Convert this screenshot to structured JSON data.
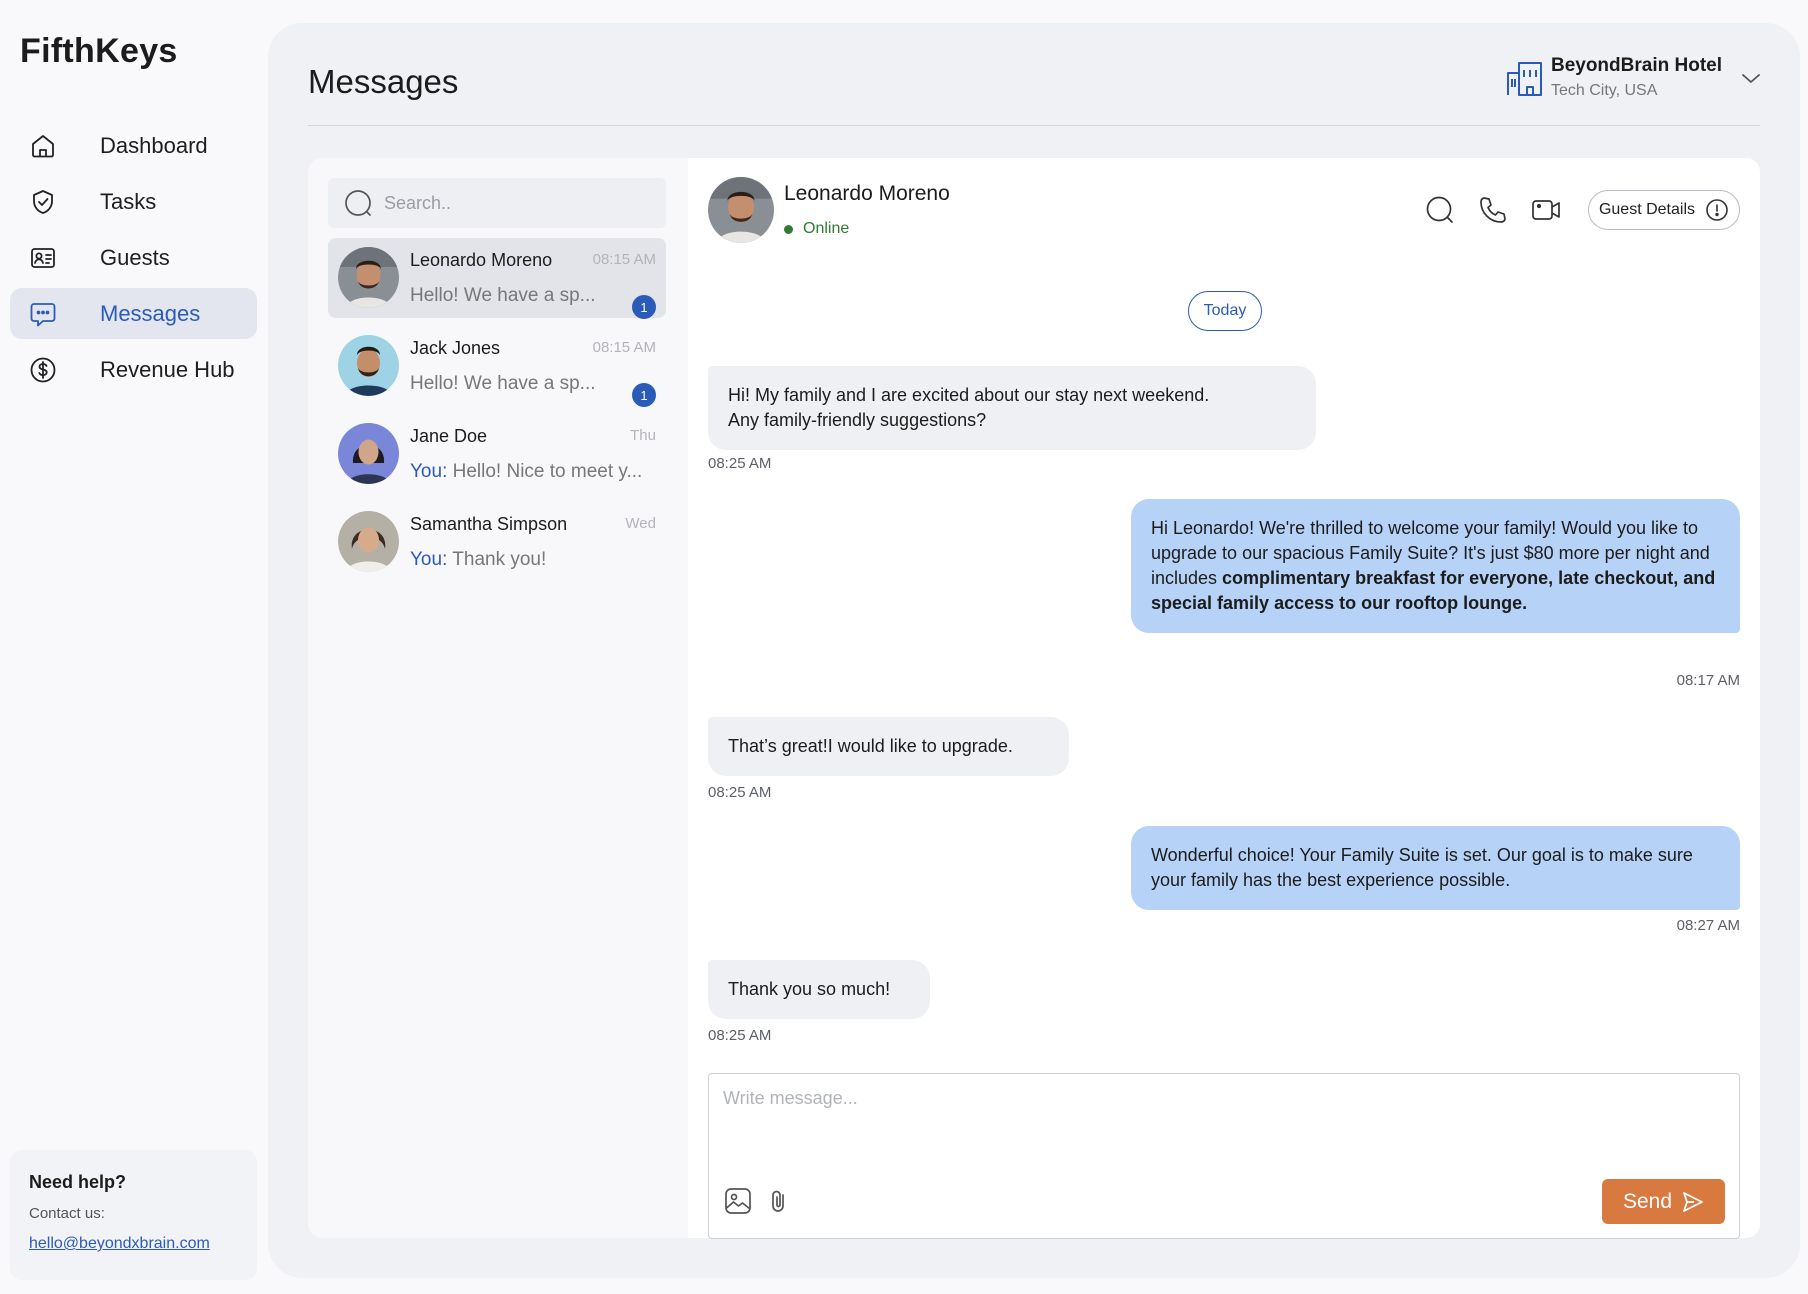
{
  "brand": "FifthKeys",
  "nav": [
    {
      "label": "Dashboard",
      "icon": "home-icon",
      "active": false
    },
    {
      "label": "Tasks",
      "icon": "check-circle-icon",
      "active": false
    },
    {
      "label": "Guests",
      "icon": "id-card-icon",
      "active": false
    },
    {
      "label": "Messages",
      "icon": "chat-bubble-icon",
      "active": true
    },
    {
      "label": "Revenue Hub",
      "icon": "dollar-circle-icon",
      "active": false
    }
  ],
  "help": {
    "title": "Need help?",
    "contact_label": "Contact us:",
    "email": "hello@beyondxbrain.com"
  },
  "header": {
    "title": "Messages",
    "hotel_name": "BeyondBrain Hotel",
    "hotel_location": "Tech City, USA"
  },
  "search": {
    "placeholder": "Search.."
  },
  "conversations": [
    {
      "name": "Leonardo Moreno",
      "time": "08:15 AM",
      "you_prefix": "",
      "preview": "Hello! We have a sp...",
      "badge": "1",
      "active": true
    },
    {
      "name": "Jack Jones",
      "time": "08:15 AM",
      "you_prefix": "",
      "preview": "Hello! We have a sp...",
      "badge": "1",
      "active": false
    },
    {
      "name": "Jane Doe",
      "time": "Thu",
      "you_prefix": "You:",
      "preview": " Hello! Nice to meet y...",
      "badge": "",
      "active": false
    },
    {
      "name": "Samantha Simpson",
      "time": "Wed",
      "you_prefix": "You:",
      "preview": " Thank you!",
      "badge": "",
      "active": false
    }
  ],
  "chat": {
    "name": "Leonardo Moreno",
    "status": "Online",
    "guest_details_label": "Guest Details",
    "date_divider": "Today",
    "messages": [
      {
        "direction": "in",
        "lines": [
          "Hi! My family and I are excited about our stay next weekend.",
          "Any family-friendly suggestions?"
        ],
        "time": "08:25 AM"
      },
      {
        "direction": "out",
        "text_plain": "Hi Leonardo! We're thrilled to welcome your family! Would you like to upgrade to our spacious Family Suite? It's just $80 more per night and includes ",
        "text_bold": "complimentary breakfast for everyone, late checkout, and special family access to our rooftop lounge.",
        "time": "08:17 AM"
      },
      {
        "direction": "in",
        "lines": [
          "That’s great!I would like to upgrade."
        ],
        "time": "08:25 AM"
      },
      {
        "direction": "out",
        "text_plain": "Wonderful choice! Your Family Suite is set. Our goal is to make sure your family has the best experience possible.",
        "text_bold": "",
        "time": "08:27 AM"
      },
      {
        "direction": "in",
        "lines": [
          "Thank you so much!"
        ],
        "time": "08:25 AM"
      }
    ]
  },
  "composer": {
    "placeholder": "Write message...",
    "send_label": "Send"
  },
  "colors": {
    "accent": "#2b5bb8",
    "online": "#2f7d32",
    "send": "#d8793f",
    "outgoing_bubble": "#b6d2f7",
    "incoming_bubble": "#eff0f4"
  }
}
